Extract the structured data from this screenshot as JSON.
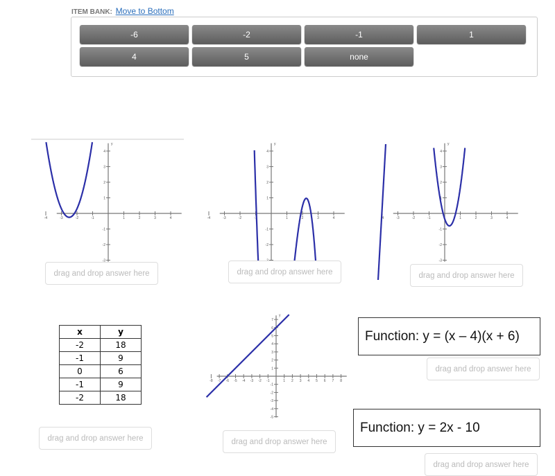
{
  "item_bank": {
    "label": "ITEM BANK:",
    "link": "Move to Bottom",
    "items": [
      "-6",
      "-2",
      "-1",
      "1",
      "4",
      "5",
      "none"
    ]
  },
  "drop_placeholder": "drag and drop answer here",
  "table": {
    "headers": [
      "x",
      "y"
    ],
    "rows": [
      [
        "-2",
        "18"
      ],
      [
        "-1",
        "9"
      ],
      [
        "0",
        "6"
      ],
      [
        "-1",
        "9"
      ],
      [
        "-2",
        "18"
      ]
    ]
  },
  "functions": [
    "Function: y = (x – 4)(x + 6)",
    "Function: y = 2x - 10"
  ],
  "graph_axis_label": "y",
  "curve_color": "#2b2fa8"
}
